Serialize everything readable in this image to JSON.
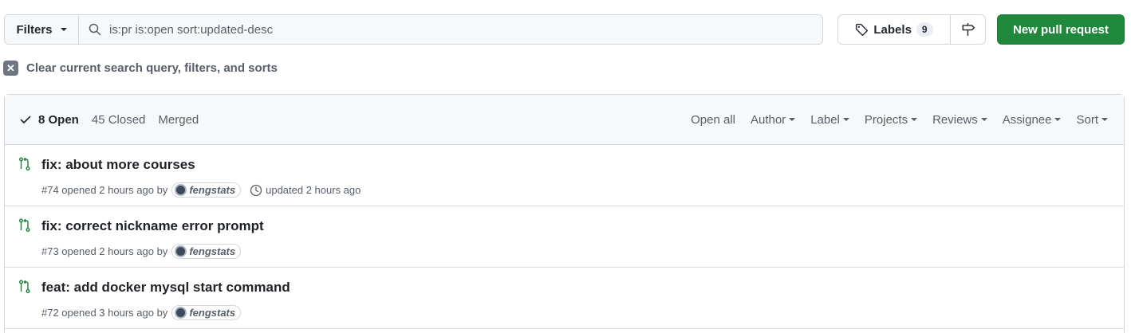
{
  "filters": {
    "label": "Filters",
    "search_value": "is:pr is:open sort:updated-desc"
  },
  "labels": {
    "label": "Labels",
    "count": "9"
  },
  "new_pr_label": "New pull request",
  "clear_text": "Clear current search query, filters, and sorts",
  "states": {
    "open": "8 Open",
    "closed": "45 Closed",
    "merged": "Merged"
  },
  "header_filters": {
    "open_all": "Open all",
    "author": "Author",
    "label": "Label",
    "projects": "Projects",
    "reviews": "Reviews",
    "assignee": "Assignee",
    "sort": "Sort"
  },
  "pull_requests": [
    {
      "title": "fix: about more courses",
      "meta": "#74 opened 2 hours ago by",
      "author": "fengstats",
      "updated": "updated 2 hours ago"
    },
    {
      "title": "fix: correct nickname error prompt",
      "meta": "#73 opened 2 hours ago by",
      "author": "fengstats"
    },
    {
      "title": "feat: add docker mysql start command",
      "meta": "#72 opened 3 hours ago by",
      "author": "fengstats"
    }
  ],
  "colors": {
    "accent_green": "#1f883d",
    "open_icon": "#1a7f37"
  }
}
